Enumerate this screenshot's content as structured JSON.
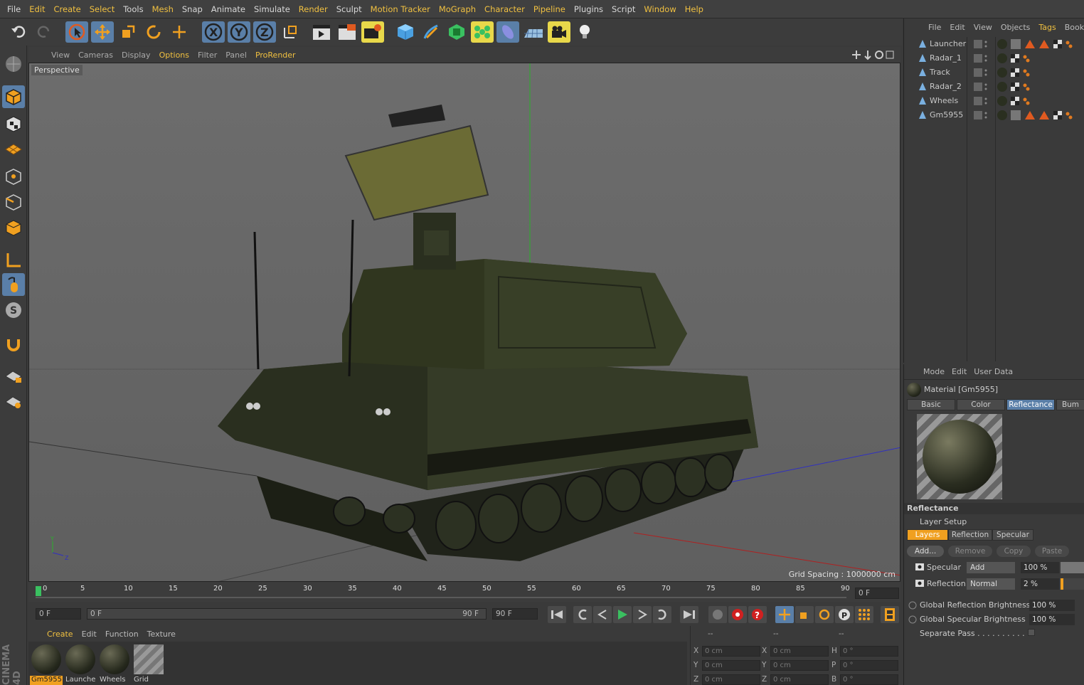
{
  "menubar": {
    "items": [
      "File",
      "Edit",
      "Create",
      "Select",
      "Tools",
      "Mesh",
      "Snap",
      "Animate",
      "Simulate",
      "Render",
      "Sculpt",
      "Motion Tracker",
      "MoGraph",
      "Character",
      "Pipeline",
      "Plugins",
      "Script",
      "Window",
      "Help"
    ]
  },
  "toolbar": {
    "icons": [
      "undo-icon",
      "redo-icon",
      "live-selection-icon",
      "move-icon",
      "scale-icon",
      "rotate-icon",
      "recent-tool-icon",
      "x-axis-icon",
      "y-axis-icon",
      "z-axis-icon",
      "coordinate-system-icon",
      "render-view-icon",
      "render-picture-viewer-icon",
      "render-settings-icon",
      "cube-icon",
      "pen-icon",
      "subdivision-icon",
      "mograph-cloner-icon",
      "deformer-icon",
      "floor-icon",
      "camera-icon",
      "light-icon"
    ],
    "axis_x": "X",
    "axis_y": "Y",
    "axis_z": "Z"
  },
  "viewport": {
    "menu": [
      "View",
      "Cameras",
      "Display",
      "Options",
      "Filter",
      "Panel",
      "ProRender"
    ],
    "label": "Perspective",
    "grid_spacing": "Grid Spacing : 1000000 cm",
    "axis_y": "Y",
    "axis_z": "Z"
  },
  "timeline": {
    "ticks": [
      "0",
      "5",
      "10",
      "15",
      "20",
      "25",
      "30",
      "35",
      "40",
      "45",
      "50",
      "55",
      "60",
      "65",
      "70",
      "75",
      "80",
      "85",
      "90"
    ],
    "current_frame": "0 F",
    "start_frame": "0 F",
    "range_start": "0 F",
    "range_end": "90 F",
    "end_frame": "90 F"
  },
  "material_manager": {
    "menu": [
      "Create",
      "Edit",
      "Function",
      "Texture"
    ],
    "materials": [
      {
        "name": "Gm5955"
      },
      {
        "name": "Launche"
      },
      {
        "name": "Wheels"
      },
      {
        "name": "Grid"
      }
    ]
  },
  "coordinates": {
    "headers": [
      "--",
      "--",
      "--"
    ],
    "rows": [
      {
        "a": "X",
        "av": "0 cm",
        "b": "X",
        "bv": "0 cm",
        "c": "H",
        "cv": "0 °"
      },
      {
        "a": "Y",
        "av": "0 cm",
        "b": "Y",
        "bv": "0 cm",
        "c": "P",
        "cv": "0 °"
      },
      {
        "a": "Z",
        "av": "0 cm",
        "b": "Z",
        "bv": "0 cm",
        "c": "B",
        "cv": "0 °"
      }
    ]
  },
  "object_manager": {
    "menu": [
      "File",
      "Edit",
      "View",
      "Objects",
      "Tags",
      "Bookm"
    ],
    "objects": [
      {
        "name": "Launcher"
      },
      {
        "name": "Radar_1"
      },
      {
        "name": "Track"
      },
      {
        "name": "Radar_2"
      },
      {
        "name": "Wheels"
      },
      {
        "name": "Gm5955"
      }
    ]
  },
  "attribute_manager": {
    "menu": [
      "Mode",
      "Edit",
      "User Data"
    ],
    "material_title": "Material [Gm5955]",
    "tabs": [
      "Basic",
      "Color",
      "Reflectance",
      "Bum"
    ],
    "section": "Reflectance",
    "layer_setup": "Layer Setup",
    "layer_tabs": [
      "Layers",
      "Reflection",
      "Specular"
    ],
    "buttons": [
      "Add...",
      "Remove",
      "Copy",
      "Paste"
    ],
    "layers": [
      {
        "name": "Specular",
        "mode": "Add",
        "value": "100 %"
      },
      {
        "name": "Reflection",
        "mode": "Normal",
        "value": "2 %"
      }
    ],
    "global_reflection_label": "Global Reflection Brightness",
    "global_reflection_value": "100 %",
    "global_specular_label": "Global Specular Brightness",
    "global_specular_value": "100 %",
    "separate_pass": "Separate Pass . . . . . . . . . . . ."
  },
  "brand": "CINEMA 4D"
}
